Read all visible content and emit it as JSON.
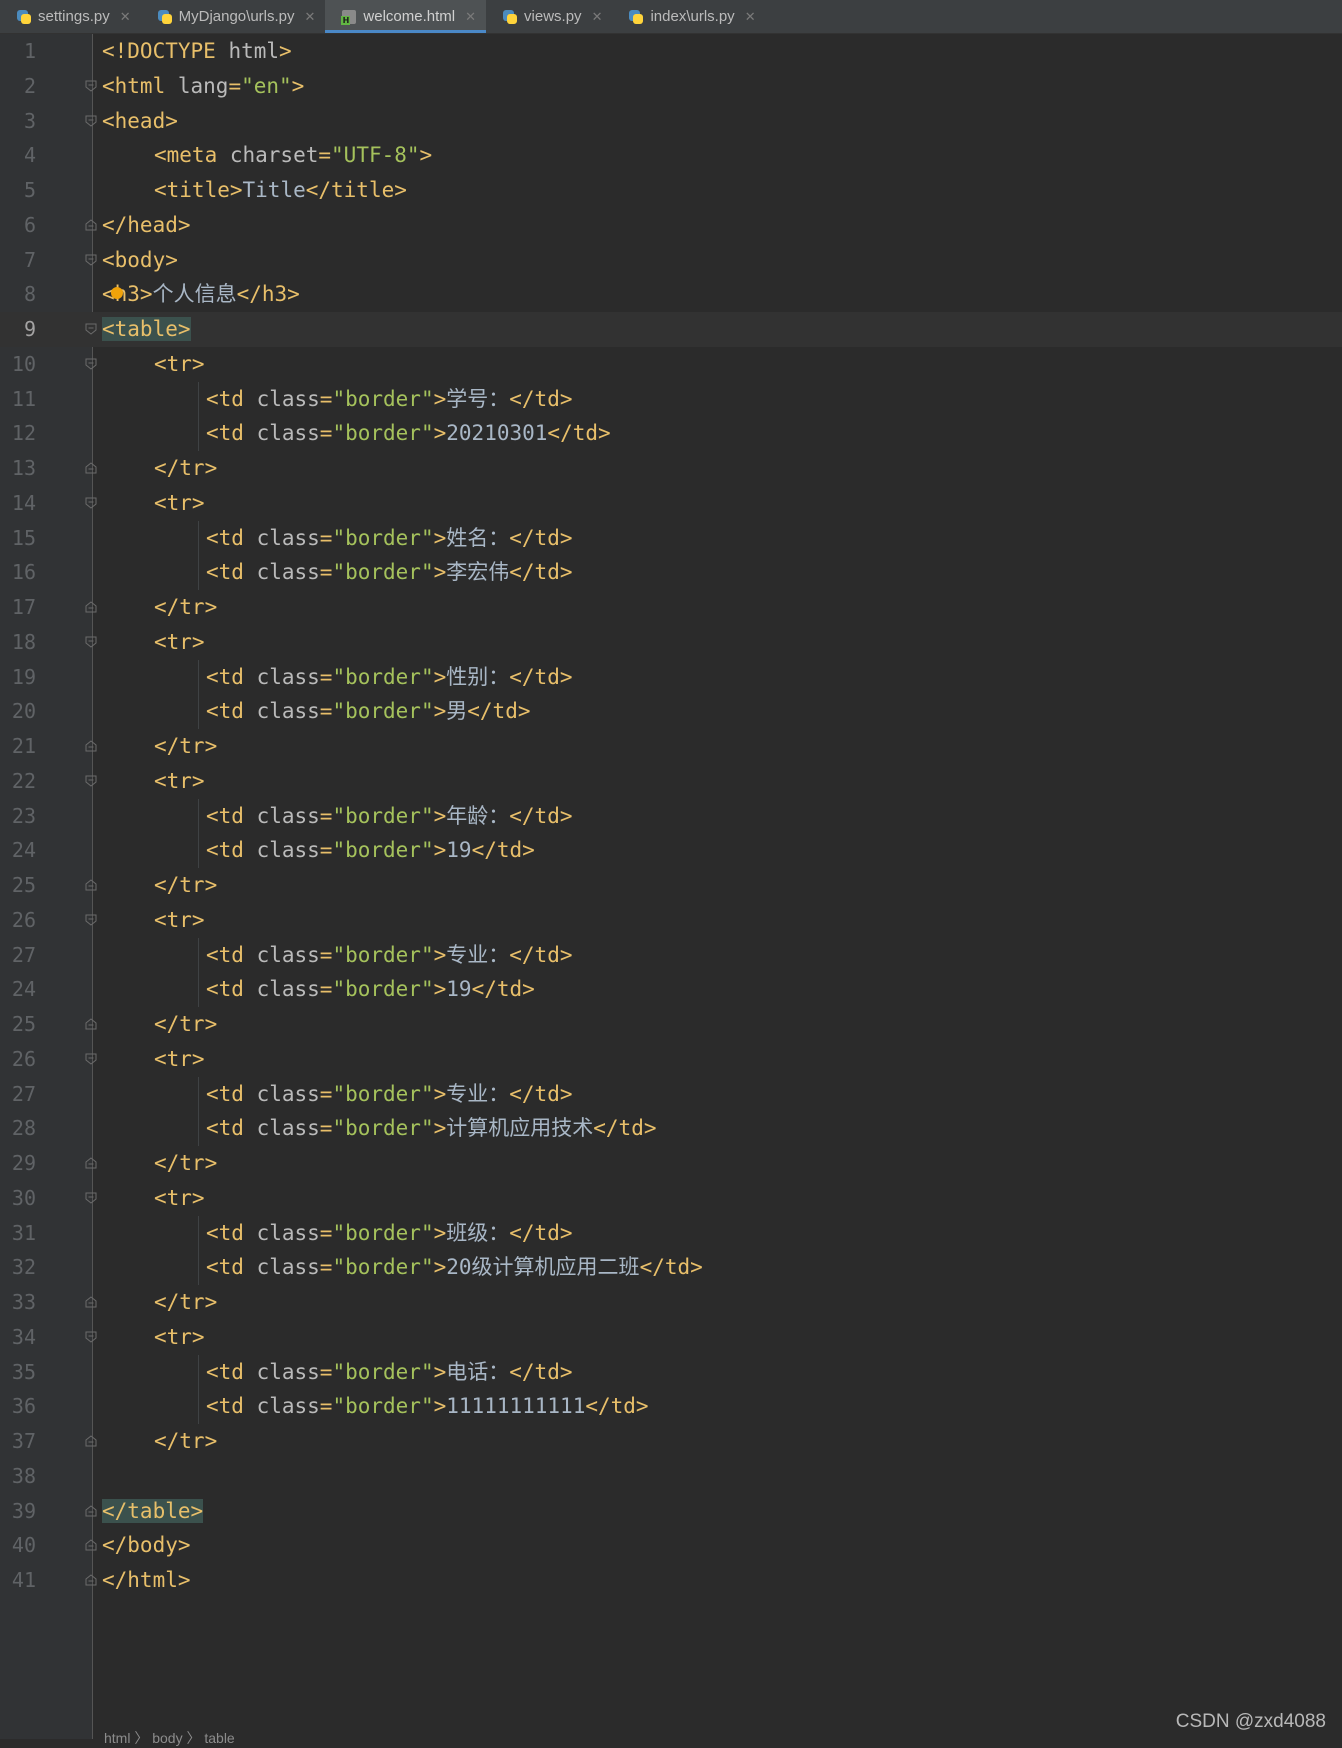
{
  "tabs": [
    {
      "label": "settings.py",
      "icon": "python-file-icon",
      "active": false
    },
    {
      "label": "MyDjango\\urls.py",
      "icon": "python-file-icon",
      "active": false
    },
    {
      "label": "welcome.html",
      "icon": "html-file-icon",
      "active": true
    },
    {
      "label": "views.py",
      "icon": "python-file-icon",
      "active": false
    },
    {
      "label": "index\\urls.py",
      "icon": "python-file-icon",
      "active": false
    }
  ],
  "editor": {
    "current_line": 9,
    "lines": [
      {
        "n": "1",
        "indent": 0,
        "parts": [
          [
            "tag",
            "<!DOCTYPE "
          ],
          [
            "attr",
            "html"
          ],
          [
            "tag",
            ">"
          ]
        ]
      },
      {
        "n": "2",
        "indent": 0,
        "fold": "open",
        "parts": [
          [
            "tag",
            "<html "
          ],
          [
            "attr",
            "lang"
          ],
          [
            "tag",
            "="
          ],
          [
            "str",
            "\"en\""
          ],
          [
            "tag",
            ">"
          ]
        ]
      },
      {
        "n": "3",
        "indent": 0,
        "fold": "open",
        "parts": [
          [
            "tag",
            "<head>"
          ]
        ]
      },
      {
        "n": "4",
        "indent": 1,
        "parts": [
          [
            "tag",
            "<meta "
          ],
          [
            "attr",
            "charset"
          ],
          [
            "tag",
            "="
          ],
          [
            "str",
            "\"UTF-8\""
          ],
          [
            "tag",
            ">"
          ]
        ]
      },
      {
        "n": "5",
        "indent": 1,
        "parts": [
          [
            "tag",
            "<title>"
          ],
          [
            "txt",
            "Title"
          ],
          [
            "tag",
            "</title>"
          ]
        ]
      },
      {
        "n": "6",
        "indent": 0,
        "fold": "close",
        "parts": [
          [
            "tag",
            "</head>"
          ]
        ]
      },
      {
        "n": "7",
        "indent": 0,
        "fold": "open",
        "parts": [
          [
            "tag",
            "<body>"
          ]
        ]
      },
      {
        "n": "8",
        "indent": 0,
        "bulb": true,
        "parts": [
          [
            "tag",
            "<h3>"
          ],
          [
            "txt",
            "个人信息"
          ],
          [
            "tag",
            "</h3>"
          ]
        ]
      },
      {
        "n": "9",
        "indent": 0,
        "fold": "open",
        "parts": [
          [
            "hltag",
            "<table>"
          ]
        ]
      },
      {
        "n": "10",
        "indent": 1,
        "fold": "open",
        "parts": [
          [
            "tag",
            "<tr>"
          ]
        ]
      },
      {
        "n": "11",
        "indent": 2,
        "parts": [
          [
            "tag",
            "<td "
          ],
          [
            "attr",
            "class"
          ],
          [
            "tag",
            "="
          ],
          [
            "str",
            "\"border\""
          ],
          [
            "tag",
            ">"
          ],
          [
            "txt",
            "学号："
          ],
          [
            "tag",
            "</td>"
          ]
        ]
      },
      {
        "n": "12",
        "indent": 2,
        "parts": [
          [
            "tag",
            "<td "
          ],
          [
            "attr",
            "class"
          ],
          [
            "tag",
            "="
          ],
          [
            "str",
            "\"border\""
          ],
          [
            "tag",
            ">"
          ],
          [
            "txt",
            "20210301"
          ],
          [
            "tag",
            "</td>"
          ]
        ]
      },
      {
        "n": "13",
        "indent": 1,
        "fold": "close",
        "parts": [
          [
            "tag",
            "</tr>"
          ]
        ]
      },
      {
        "n": "14",
        "indent": 1,
        "fold": "open",
        "parts": [
          [
            "tag",
            "<tr>"
          ]
        ]
      },
      {
        "n": "15",
        "indent": 2,
        "parts": [
          [
            "tag",
            "<td "
          ],
          [
            "attr",
            "class"
          ],
          [
            "tag",
            "="
          ],
          [
            "str",
            "\"border\""
          ],
          [
            "tag",
            ">"
          ],
          [
            "txt",
            "姓名："
          ],
          [
            "tag",
            "</td>"
          ]
        ]
      },
      {
        "n": "16",
        "indent": 2,
        "parts": [
          [
            "tag",
            "<td "
          ],
          [
            "attr",
            "class"
          ],
          [
            "tag",
            "="
          ],
          [
            "str",
            "\"border\""
          ],
          [
            "tag",
            ">"
          ],
          [
            "txt",
            "李宏伟"
          ],
          [
            "tag",
            "</td>"
          ]
        ]
      },
      {
        "n": "17",
        "indent": 1,
        "fold": "close",
        "parts": [
          [
            "tag",
            "</tr>"
          ]
        ]
      },
      {
        "n": "18",
        "indent": 1,
        "fold": "open",
        "parts": [
          [
            "tag",
            "<tr>"
          ]
        ]
      },
      {
        "n": "19",
        "indent": 2,
        "parts": [
          [
            "tag",
            "<td "
          ],
          [
            "attr",
            "class"
          ],
          [
            "tag",
            "="
          ],
          [
            "str",
            "\"border\""
          ],
          [
            "tag",
            ">"
          ],
          [
            "txt",
            "性别："
          ],
          [
            "tag",
            "</td>"
          ]
        ]
      },
      {
        "n": "20",
        "indent": 2,
        "parts": [
          [
            "tag",
            "<td "
          ],
          [
            "attr",
            "class"
          ],
          [
            "tag",
            "="
          ],
          [
            "str",
            "\"border\""
          ],
          [
            "tag",
            ">"
          ],
          [
            "txt",
            "男"
          ],
          [
            "tag",
            "</td>"
          ]
        ]
      },
      {
        "n": "21",
        "indent": 1,
        "fold": "close",
        "parts": [
          [
            "tag",
            "</tr>"
          ]
        ]
      },
      {
        "n": "22",
        "indent": 1,
        "fold": "open",
        "parts": [
          [
            "tag",
            "<tr>"
          ]
        ]
      },
      {
        "n": "23",
        "indent": 2,
        "parts": [
          [
            "tag",
            "<td "
          ],
          [
            "attr",
            "class"
          ],
          [
            "tag",
            "="
          ],
          [
            "str",
            "\"border\""
          ],
          [
            "tag",
            ">"
          ],
          [
            "txt",
            "年龄："
          ],
          [
            "tag",
            "</td>"
          ]
        ]
      },
      {
        "n": "24",
        "indent": 2,
        "parts": [
          [
            "tag",
            "<td "
          ],
          [
            "attr",
            "class"
          ],
          [
            "tag",
            "="
          ],
          [
            "str",
            "\"border\""
          ],
          [
            "tag",
            ">"
          ],
          [
            "txt",
            "19"
          ],
          [
            "tag",
            "</td>"
          ]
        ]
      },
      {
        "n": "25",
        "indent": 1,
        "fold": "close",
        "parts": [
          [
            "tag",
            "</tr>"
          ]
        ]
      },
      {
        "n": "26",
        "indent": 1,
        "fold": "open",
        "parts": [
          [
            "tag",
            "<tr>"
          ]
        ]
      },
      {
        "n": "27",
        "indent": 2,
        "parts": [
          [
            "tag",
            "<td "
          ],
          [
            "attr",
            "class"
          ],
          [
            "tag",
            "="
          ],
          [
            "str",
            "\"border\""
          ],
          [
            "tag",
            ">"
          ],
          [
            "txt",
            "专业："
          ],
          [
            "tag",
            "</td>"
          ]
        ]
      },
      {
        "n": "24",
        "indent": 2,
        "parts": [
          [
            "tag",
            "<td "
          ],
          [
            "attr",
            "class"
          ],
          [
            "tag",
            "="
          ],
          [
            "str",
            "\"border\""
          ],
          [
            "tag",
            ">"
          ],
          [
            "txt",
            "19"
          ],
          [
            "tag",
            "</td>"
          ]
        ]
      },
      {
        "n": "25",
        "indent": 1,
        "fold": "close",
        "parts": [
          [
            "tag",
            "</tr>"
          ]
        ]
      },
      {
        "n": "26",
        "indent": 1,
        "fold": "open",
        "parts": [
          [
            "tag",
            "<tr>"
          ]
        ]
      },
      {
        "n": "27",
        "indent": 2,
        "parts": [
          [
            "tag",
            "<td "
          ],
          [
            "attr",
            "class"
          ],
          [
            "tag",
            "="
          ],
          [
            "str",
            "\"border\""
          ],
          [
            "tag",
            ">"
          ],
          [
            "txt",
            "专业："
          ],
          [
            "tag",
            "</td>"
          ]
        ]
      },
      {
        "n": "28",
        "indent": 2,
        "parts": [
          [
            "tag",
            "<td "
          ],
          [
            "attr",
            "class"
          ],
          [
            "tag",
            "="
          ],
          [
            "str",
            "\"border\""
          ],
          [
            "tag",
            ">"
          ],
          [
            "txt",
            "计算机应用技术"
          ],
          [
            "tag",
            "</td>"
          ]
        ]
      },
      {
        "n": "29",
        "indent": 1,
        "fold": "close",
        "parts": [
          [
            "tag",
            "</tr>"
          ]
        ]
      },
      {
        "n": "30",
        "indent": 1,
        "fold": "open",
        "parts": [
          [
            "tag",
            "<tr>"
          ]
        ]
      },
      {
        "n": "31",
        "indent": 2,
        "parts": [
          [
            "tag",
            "<td "
          ],
          [
            "attr",
            "class"
          ],
          [
            "tag",
            "="
          ],
          [
            "str",
            "\"border\""
          ],
          [
            "tag",
            ">"
          ],
          [
            "txt",
            "班级："
          ],
          [
            "tag",
            "</td>"
          ]
        ]
      },
      {
        "n": "32",
        "indent": 2,
        "parts": [
          [
            "tag",
            "<td "
          ],
          [
            "attr",
            "class"
          ],
          [
            "tag",
            "="
          ],
          [
            "str",
            "\"border\""
          ],
          [
            "tag",
            ">"
          ],
          [
            "txt",
            "20级计算机应用二班"
          ],
          [
            "tag",
            "</td>"
          ]
        ]
      },
      {
        "n": "33",
        "indent": 1,
        "fold": "close",
        "parts": [
          [
            "tag",
            "</tr>"
          ]
        ]
      },
      {
        "n": "34",
        "indent": 1,
        "fold": "open",
        "parts": [
          [
            "tag",
            "<tr>"
          ]
        ]
      },
      {
        "n": "35",
        "indent": 2,
        "parts": [
          [
            "tag",
            "<td "
          ],
          [
            "attr",
            "class"
          ],
          [
            "tag",
            "="
          ],
          [
            "str",
            "\"border\""
          ],
          [
            "tag",
            ">"
          ],
          [
            "txt",
            "电话："
          ],
          [
            "tag",
            "</td>"
          ]
        ]
      },
      {
        "n": "36",
        "indent": 2,
        "parts": [
          [
            "tag",
            "<td "
          ],
          [
            "attr",
            "class"
          ],
          [
            "tag",
            "="
          ],
          [
            "str",
            "\"border\""
          ],
          [
            "tag",
            ">"
          ],
          [
            "txt",
            "11111111111"
          ],
          [
            "tag",
            "</td>"
          ]
        ]
      },
      {
        "n": "37",
        "indent": 1,
        "fold": "close",
        "parts": [
          [
            "tag",
            "</tr>"
          ]
        ]
      },
      {
        "n": "38",
        "indent": 0,
        "parts": []
      },
      {
        "n": "39",
        "indent": 0,
        "fold": "close",
        "parts": [
          [
            "hltag",
            "</table>"
          ]
        ]
      },
      {
        "n": "40",
        "indent": 0,
        "fold": "close",
        "parts": [
          [
            "tag",
            "</body>"
          ]
        ]
      },
      {
        "n": "41",
        "indent": 0,
        "fold": "close",
        "parts": [
          [
            "tag",
            "</html>"
          ]
        ]
      }
    ]
  },
  "breadcrumb": "html 〉 body 〉 table",
  "watermark": "CSDN @zxd4088"
}
